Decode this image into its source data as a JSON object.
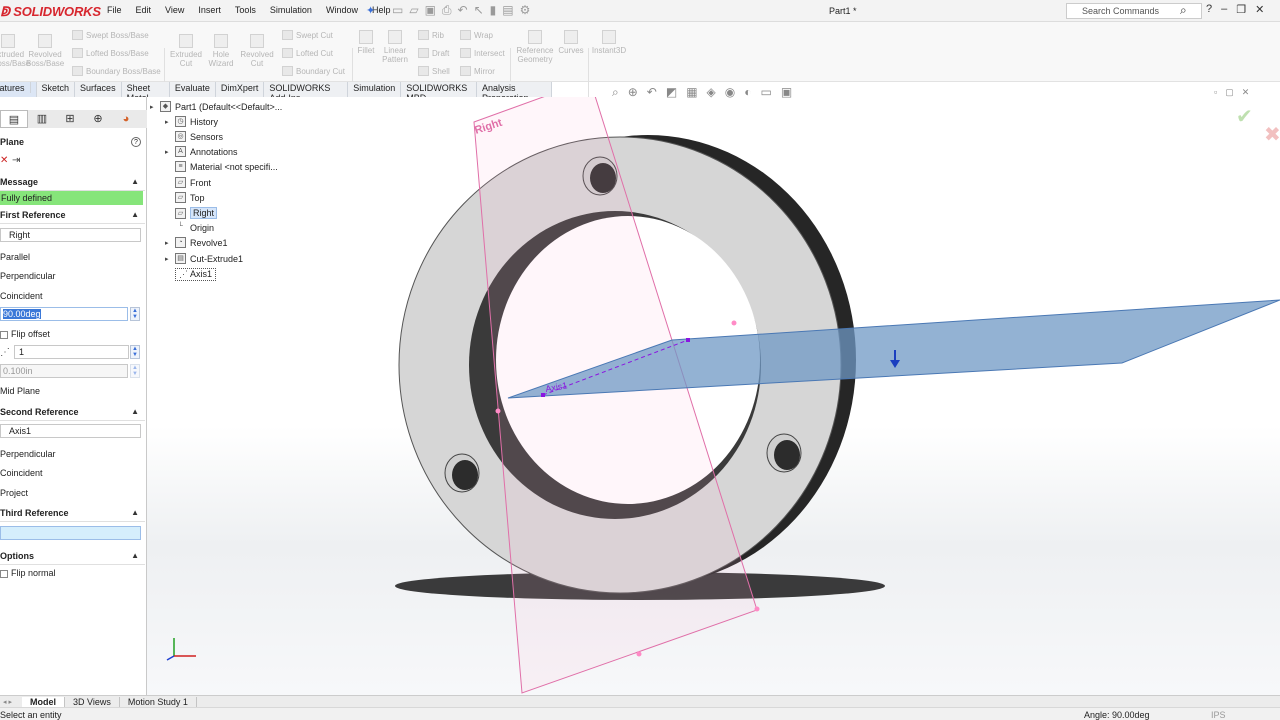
{
  "app": {
    "logo": "SOLIDWORKS",
    "doc_title": "Part1 *"
  },
  "menu": [
    "File",
    "Edit",
    "View",
    "Insert",
    "Tools",
    "Simulation",
    "Window",
    "Help"
  ],
  "search": {
    "placeholder": "Search Commands"
  },
  "ribbon": {
    "extruded_boss": "Extruded\nBoss/Base",
    "revolved_boss": "Revolved\nBoss/Base",
    "swept_boss": "Swept Boss/Base",
    "lofted_boss": "Lofted Boss/Base",
    "boundary_boss": "Boundary Boss/Base",
    "extruded_cut": "Extruded\nCut",
    "hole_wizard": "Hole\nWizard",
    "revolved_cut": "Revolved\nCut",
    "swept_cut": "Swept Cut",
    "lofted_cut": "Lofted Cut",
    "boundary_cut": "Boundary Cut",
    "fillet": "Fillet",
    "linear_pattern": "Linear\nPattern",
    "rib": "Rib",
    "draft": "Draft",
    "shell": "Shell",
    "wrap": "Wrap",
    "intersect": "Intersect",
    "mirror": "Mirror",
    "reference_geometry": "Reference\nGeometry",
    "curves": "Curves",
    "instant3d": "Instant3D"
  },
  "command_tabs": [
    "Features",
    "Sketch",
    "Surfaces",
    "Sheet Metal",
    "Evaluate",
    "DimXpert",
    "SOLIDWORKS Add-Ins",
    "Simulation",
    "SOLIDWORKS MBD",
    "Analysis Preparation"
  ],
  "property_manager": {
    "title": "Plane",
    "message_header": "Message",
    "message": "Fully defined",
    "first_reference": {
      "header": "First Reference",
      "entity": "Right",
      "options": [
        "Parallel",
        "Perpendicular",
        "Coincident"
      ],
      "angle": "90.00deg",
      "flip_offset": "Flip offset",
      "instances": "1",
      "distance": "0.100in",
      "mid_plane": "Mid Plane"
    },
    "second_reference": {
      "header": "Second Reference",
      "entity": "Axis1",
      "options": [
        "Perpendicular",
        "Coincident",
        "Project"
      ]
    },
    "third_reference": {
      "header": "Third Reference",
      "entity": ""
    },
    "options": {
      "header": "Options",
      "flip_normal": "Flip normal"
    }
  },
  "feature_tree": [
    {
      "label": "Part1  (Default<<Default>...",
      "icon": "part-icon",
      "expander": true
    },
    {
      "label": "History",
      "icon": "history-icon",
      "expander": true
    },
    {
      "label": "Sensors",
      "icon": "sensor-icon",
      "expander": false
    },
    {
      "label": "Annotations",
      "icon": "annotation-icon",
      "expander": true
    },
    {
      "label": "Material <not specifi...",
      "icon": "material-icon",
      "expander": false
    },
    {
      "label": "Front",
      "icon": "plane-icon",
      "expander": false
    },
    {
      "label": "Top",
      "icon": "plane-icon",
      "expander": false
    },
    {
      "label": "Right",
      "icon": "plane-icon",
      "expander": false
    },
    {
      "label": "Origin",
      "icon": "origin-icon",
      "expander": false
    },
    {
      "label": "Revolve1",
      "icon": "revolve-icon",
      "expander": true
    },
    {
      "label": "Cut-Extrude1",
      "icon": "cut-extrude-icon",
      "expander": true
    },
    {
      "label": "Axis1",
      "icon": "axis-icon",
      "expander": false
    }
  ],
  "viewport": {
    "plane_label": "Right",
    "axis_label": "Axis1"
  },
  "bottom_tabs": [
    "Model",
    "3D Views",
    "Motion Study 1"
  ],
  "status": {
    "message": "Select an entity",
    "angle": "Angle: 90.00deg",
    "units": "IPS"
  },
  "colors": {
    "brand": "#d7262e",
    "defined": "#86e57a",
    "first_ref": "#ff8bc6",
    "second_ref": "#8a16e0",
    "third_ref": "#1bd84a",
    "plane_preview": "#7fa6cf"
  }
}
